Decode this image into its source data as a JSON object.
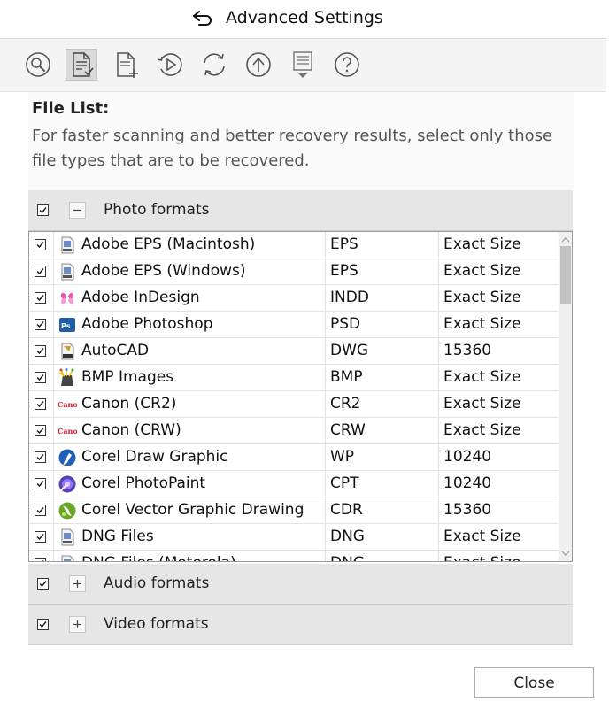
{
  "window": {
    "title": "Advanced Settings"
  },
  "toolbar": {
    "icons": [
      "search-icon",
      "file-list-icon",
      "new-file-icon",
      "play-icon",
      "refresh-icon",
      "upload-icon",
      "file-menu-icon",
      "help-icon"
    ],
    "active": "file-list-icon"
  },
  "content": {
    "heading": "File List:",
    "description": "For faster scanning and better recovery results, select only those file types that are to be recovered."
  },
  "groups": [
    {
      "label": "Photo formats",
      "checked": true,
      "expanded": true
    },
    {
      "label": "Audio formats",
      "checked": true,
      "expanded": false
    },
    {
      "label": "Video formats",
      "checked": true,
      "expanded": false
    }
  ],
  "files": [
    {
      "name": "Adobe EPS (Macintosh)",
      "ext": "EPS",
      "size": "Exact Size",
      "checked": true,
      "icon": "eps-file-icon"
    },
    {
      "name": "Adobe EPS (Windows)",
      "ext": "EPS",
      "size": "Exact Size",
      "checked": true,
      "icon": "eps-file-icon"
    },
    {
      "name": "Adobe InDesign",
      "ext": "INDD",
      "size": "Exact Size",
      "checked": true,
      "icon": "indesign-icon"
    },
    {
      "name": "Adobe Photoshop",
      "ext": "PSD",
      "size": "Exact Size",
      "checked": true,
      "icon": "photoshop-icon"
    },
    {
      "name": "AutoCAD",
      "ext": "DWG",
      "size": "15360",
      "checked": true,
      "icon": "dwg-file-icon"
    },
    {
      "name": "BMP Images",
      "ext": "BMP",
      "size": "Exact Size",
      "checked": true,
      "icon": "bmp-icon"
    },
    {
      "name": "Canon (CR2)",
      "ext": "CR2",
      "size": "Exact Size",
      "checked": true,
      "icon": "canon-icon"
    },
    {
      "name": "Canon (CRW)",
      "ext": "CRW",
      "size": "Exact Size",
      "checked": true,
      "icon": "canon-icon"
    },
    {
      "name": "Corel Draw Graphic",
      "ext": "WP",
      "size": "10240",
      "checked": true,
      "icon": "corel-draw-icon"
    },
    {
      "name": "Corel PhotoPaint",
      "ext": "CPT",
      "size": "10240",
      "checked": true,
      "icon": "corel-photopaint-icon"
    },
    {
      "name": "Corel Vector Graphic Drawing",
      "ext": "CDR",
      "size": "15360",
      "checked": true,
      "icon": "corel-vector-icon"
    },
    {
      "name": "DNG Files",
      "ext": "DNG",
      "size": "Exact Size",
      "checked": true,
      "icon": "dng-file-icon"
    },
    {
      "name": "DNG Files (Motorola)",
      "ext": "DNG",
      "size": "Exact Size",
      "checked": true,
      "icon": "dng-file-icon"
    }
  ],
  "canon_logo_text": "Canon",
  "close_label": "Close",
  "colors": {
    "accent": "#1e5fa8",
    "header_bg": "#e6e6e6",
    "toolbar_bg": "#f4f4f4"
  }
}
